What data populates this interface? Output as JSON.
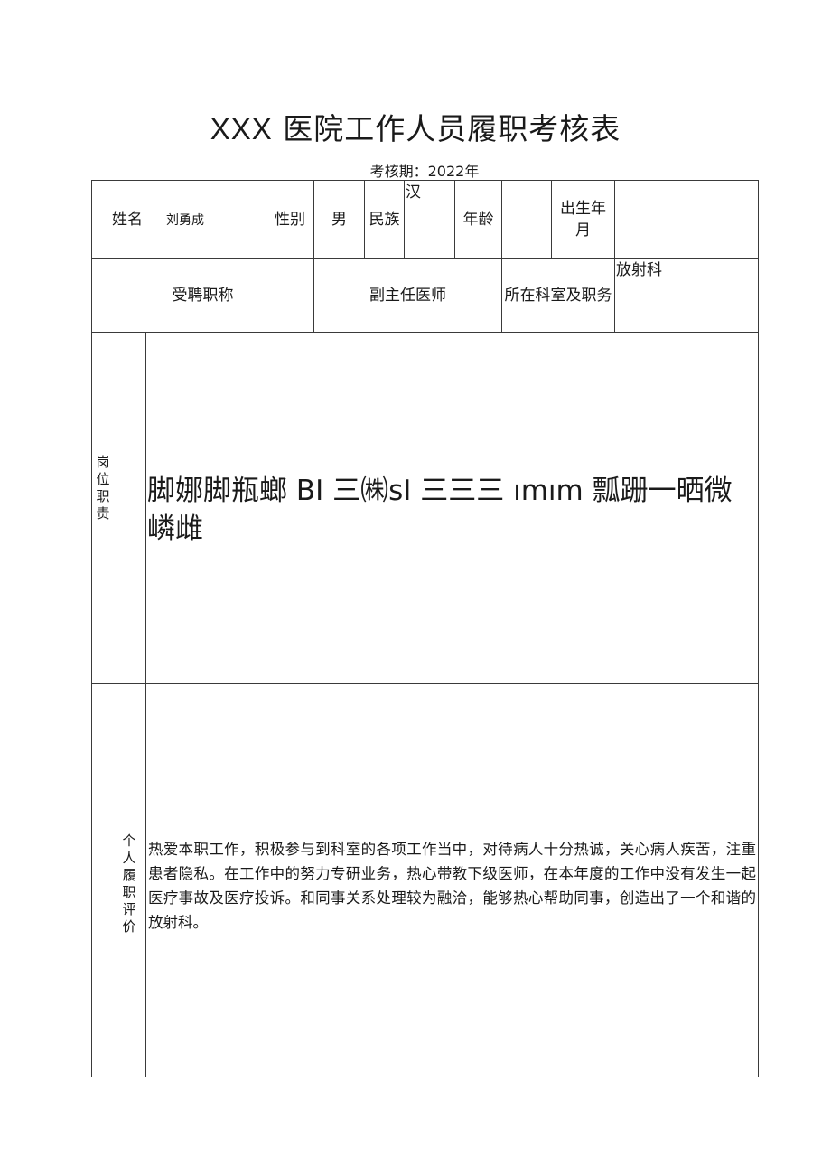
{
  "document": {
    "title_prefix": "XXX",
    "title_rest": "医院工作人员履职考核表",
    "assessment_period": "考核期：2022年"
  },
  "table": {
    "row1": {
      "name_label": "姓名",
      "name_value": "刘勇成",
      "gender_label": "性别",
      "gender_value": "男",
      "ethnicity_label": "民族",
      "ethnicity_value": "汉",
      "age_label": "年龄",
      "age_value": "",
      "birth_label": "出生年月",
      "birth_value": ""
    },
    "row2": {
      "title_label": "受聘职称",
      "title_value": "副主任医师",
      "dept_label": "所在科室及职务",
      "dept_value": "放射科"
    },
    "row3": {
      "duties_label": "岗位职责",
      "duties_value": "脚娜脚瓶螂 BI 三㈱sI 三三三 ımım 瓢跚一晒微嶙雌"
    },
    "row4": {
      "evaluation_label": "个人履职评价",
      "evaluation_value": "热爱本职工作，积极参与到科室的各项工作当中，对待病人十分热诚，关心病人疾苦，注重患者隐私。在工作中的努力专研业务，热心带教下级医师，在本年度的工作中没有发生一起医疗事故及医疗投诉。和同事关系处理较为融洽，能够热心帮助同事，创造出了一个和谐的放射科。"
    }
  }
}
